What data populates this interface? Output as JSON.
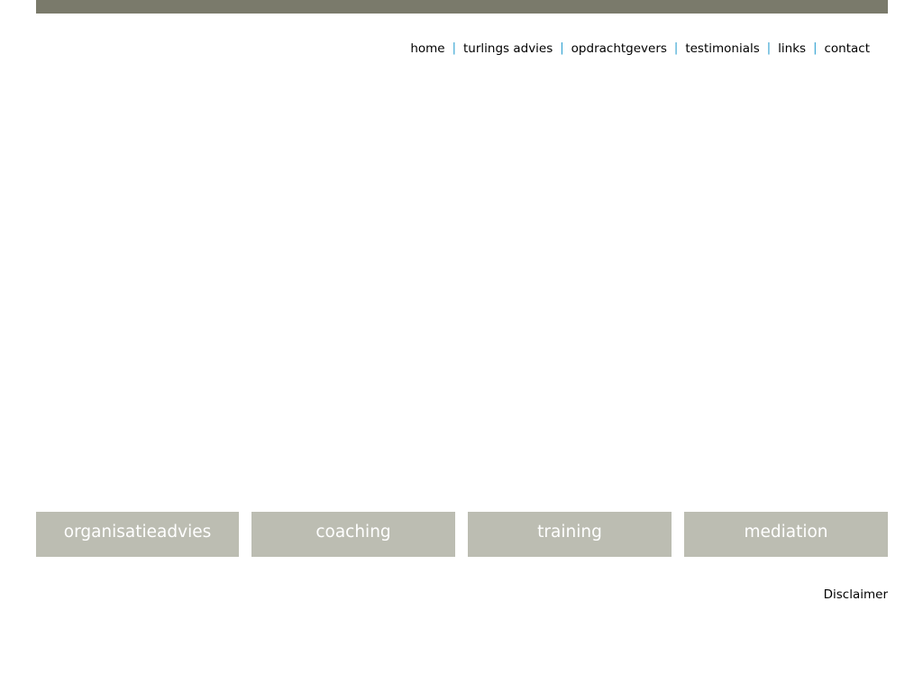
{
  "nav": {
    "items": [
      {
        "label": "home"
      },
      {
        "label": "turlings advies"
      },
      {
        "label": "opdrachtgevers"
      },
      {
        "label": "testimonials"
      },
      {
        "label": "links"
      },
      {
        "label": "contact"
      }
    ],
    "separator": "|",
    "separator_color": "#2a9fd0"
  },
  "services": {
    "items": [
      {
        "label": "organisatieadvies"
      },
      {
        "label": "coaching"
      },
      {
        "label": "training"
      },
      {
        "label": "mediation"
      }
    ],
    "tile_color": "#bcbdb2"
  },
  "footer": {
    "disclaimer_label": "Disclaimer"
  },
  "colors": {
    "top_bar": "#7a7a6b",
    "background": "#ffffff"
  }
}
